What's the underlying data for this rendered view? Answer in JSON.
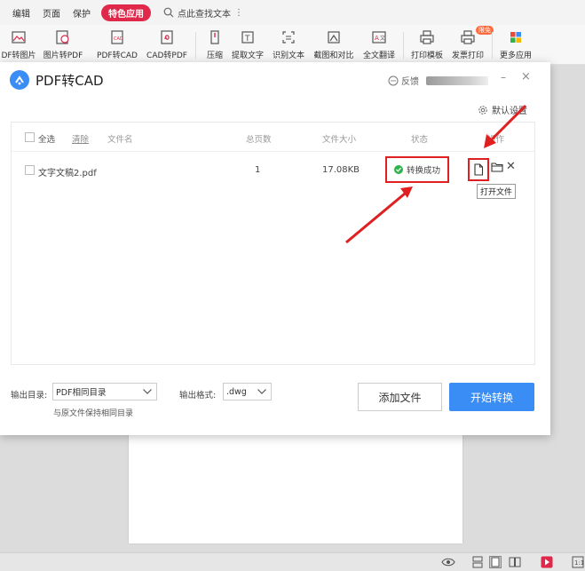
{
  "menubar": {
    "items": [
      "编辑",
      "页面",
      "保护"
    ],
    "special": "特色应用",
    "search_text": "点此查找文本",
    "more": "⋮"
  },
  "ribbon": {
    "tools": [
      {
        "label": "DF转图片",
        "icon": "pdf-to-image-icon"
      },
      {
        "label": "图片转PDF",
        "icon": "image-to-pdf-icon"
      },
      {
        "label": "PDF转CAD",
        "icon": "pdf-to-cad-icon"
      },
      {
        "label": "CAD转PDF",
        "icon": "cad-to-pdf-icon"
      },
      {
        "label": "压缩",
        "icon": "compress-icon"
      },
      {
        "label": "提取文字",
        "icon": "extract-text-icon"
      },
      {
        "label": "识别文本",
        "icon": "recognize-text-icon"
      },
      {
        "label": "截图和对比",
        "icon": "screenshot-compare-icon"
      },
      {
        "label": "全文翻译",
        "icon": "translate-icon"
      },
      {
        "label": "打印模板",
        "icon": "print-template-icon"
      },
      {
        "label": "发票打印",
        "icon": "invoice-print-icon"
      },
      {
        "label": "更多应用",
        "icon": "more-apps-icon"
      }
    ],
    "badge": "限免"
  },
  "dialog": {
    "title": "PDF转CAD",
    "feedback": "反馈",
    "min_symbol": "–",
    "close_symbol": "×",
    "default_settings": "默认设置",
    "table": {
      "headers": {
        "select_all": "全选",
        "clear": "清除",
        "filename": "文件名",
        "pages": "总页数",
        "size": "文件大小",
        "status": "状态",
        "action": "操作"
      },
      "rows": [
        {
          "filename": "文字文稿2.pdf",
          "pages": "1",
          "size": "17.08KB",
          "status": "转换成功"
        }
      ]
    },
    "tooltip": "打开文件",
    "delete_symbol": "✕",
    "output_dir_label": "输出目录:",
    "output_dir_value": "PDF相同目录",
    "output_dir_hint": "与原文件保持相同目录",
    "output_format_label": "输出格式:",
    "output_format_value": ".dwg",
    "add_file": "添加文件",
    "start": "开始转换"
  },
  "colors": {
    "accent_red": "#e0284a",
    "highlight_red": "#e02020",
    "primary_blue": "#3a8df5",
    "success_green": "#2fb34b"
  }
}
